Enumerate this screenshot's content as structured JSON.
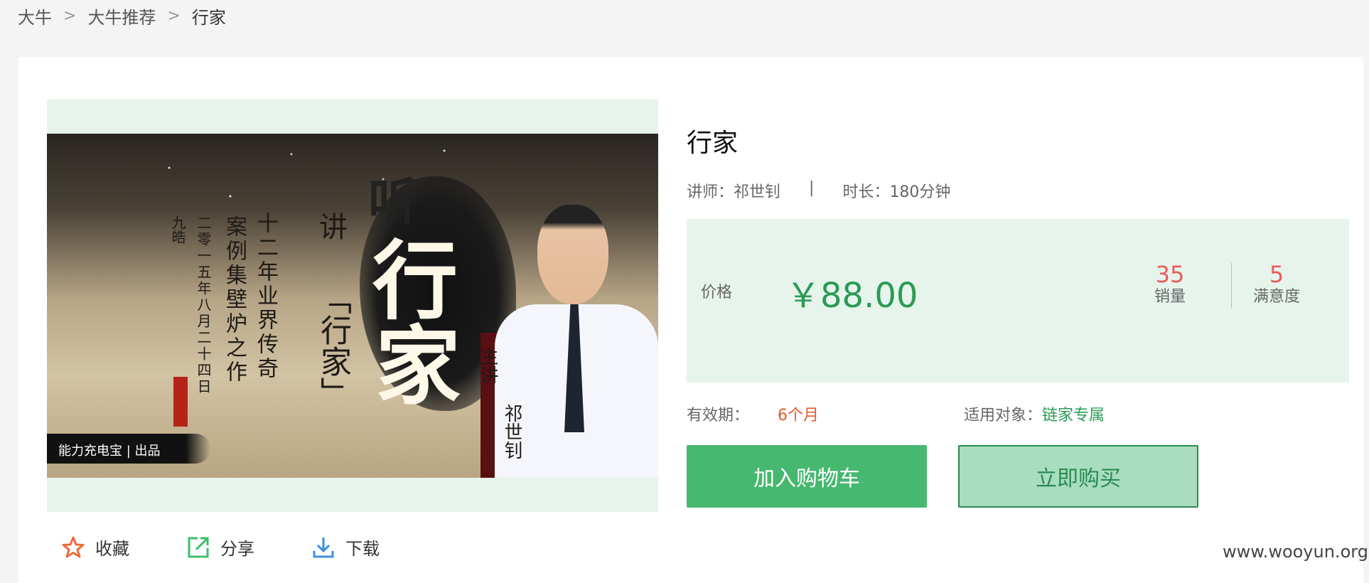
{
  "breadcrumb": {
    "items": [
      "大牛",
      "大牛推荐",
      "行家"
    ],
    "separator": ">"
  },
  "product": {
    "title": "行家",
    "teacher_label": "讲师：祁世钊",
    "separator": "|",
    "duration_label": "时长：180分钟"
  },
  "cover": {
    "title_small": "听",
    "title_big_1": "行",
    "title_big_2": "家",
    "talk_text": "讲",
    "talk_subject": "「行家」",
    "calligraphy_col1": "十二年业界传奇",
    "calligraphy_col2": "案例集壁炉之作",
    "calligraphy_col3": "二零一五年八月二十四日",
    "calligraphy_col4": "九皓",
    "host_label": "主讲",
    "host_name": "祁世钊",
    "brand": "能力充电宝 | 出品"
  },
  "price": {
    "label": "价格",
    "value": "￥88.00",
    "sales_num": "35",
    "sales_label": "销量",
    "satisfaction_num": "5",
    "satisfaction_label": "满意度"
  },
  "details": {
    "validity_label": "有效期：",
    "validity_value": "6个月",
    "audience_label": "适用对象：",
    "audience_value": "链家专属"
  },
  "buttons": {
    "add_to_cart": "加入购物车",
    "buy_now": "立即购买"
  },
  "actions": {
    "favorite": "收藏",
    "share": "分享",
    "download": "下载"
  },
  "watermark": "www.wooyun.org",
  "colors": {
    "accent_green": "#46b86f",
    "price_green": "#2a9a55",
    "highlight_red": "#ec5b5b",
    "validity_orange": "#e15a2b",
    "panel_bg": "#e6f4ec"
  }
}
